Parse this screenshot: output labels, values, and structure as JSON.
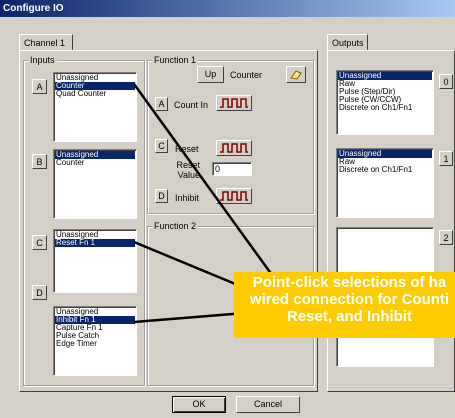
{
  "window": {
    "title": "Configure IO"
  },
  "tabs": {
    "channel": "Channel 1",
    "outputs": "Outputs"
  },
  "inputs": {
    "label": "Inputs",
    "rows": [
      {
        "button": "A",
        "options": [
          "Unassigned",
          "Counter",
          "Quad Counter"
        ],
        "selected": 1
      },
      {
        "button": "B",
        "options": [
          "Unassigned",
          "Counter"
        ],
        "selected": 0
      },
      {
        "button": "C",
        "options": [
          "Unassigned",
          "Reset Fn 1"
        ],
        "selected": 1
      },
      {
        "button": "D",
        "options": [
          "Unassigned",
          "Inhibit Fn 1",
          "Capture Fn 1",
          "Pulse Catch",
          "Edge Timer"
        ],
        "selected": 1
      }
    ]
  },
  "function1": {
    "label": "Function 1",
    "direction_button": "Up",
    "mode": "Counter",
    "count_in": {
      "button": "A",
      "label": "Count In"
    },
    "reset": {
      "button": "C",
      "label": "Reset"
    },
    "reset_value": {
      "label": "Reset Value",
      "value": "0"
    },
    "inhibit": {
      "button": "D",
      "label": "Inhibit"
    }
  },
  "function2": {
    "label": "Function 2"
  },
  "outputs": {
    "rows": [
      {
        "button": "0",
        "options": [
          "Unassigned",
          "Raw",
          "Pulse (Step/Dir)",
          "Pulse (CW/CCW)",
          "Discrete on Ch1/Fn1"
        ],
        "selected": 0
      },
      {
        "button": "1",
        "options": [
          "Unassigned",
          "Raw",
          "Discrete on Ch1/Fn1"
        ],
        "selected": 0
      },
      {
        "button": "2",
        "options": [],
        "selected": -1
      }
    ]
  },
  "footer": {
    "ok": "OK",
    "cancel": "Cancel"
  },
  "callout": {
    "lines": [
      "Point-click selections of ha",
      "wired connection for Counti",
      "Reset, and Inhibit"
    ],
    "color": "#ffcc00"
  }
}
